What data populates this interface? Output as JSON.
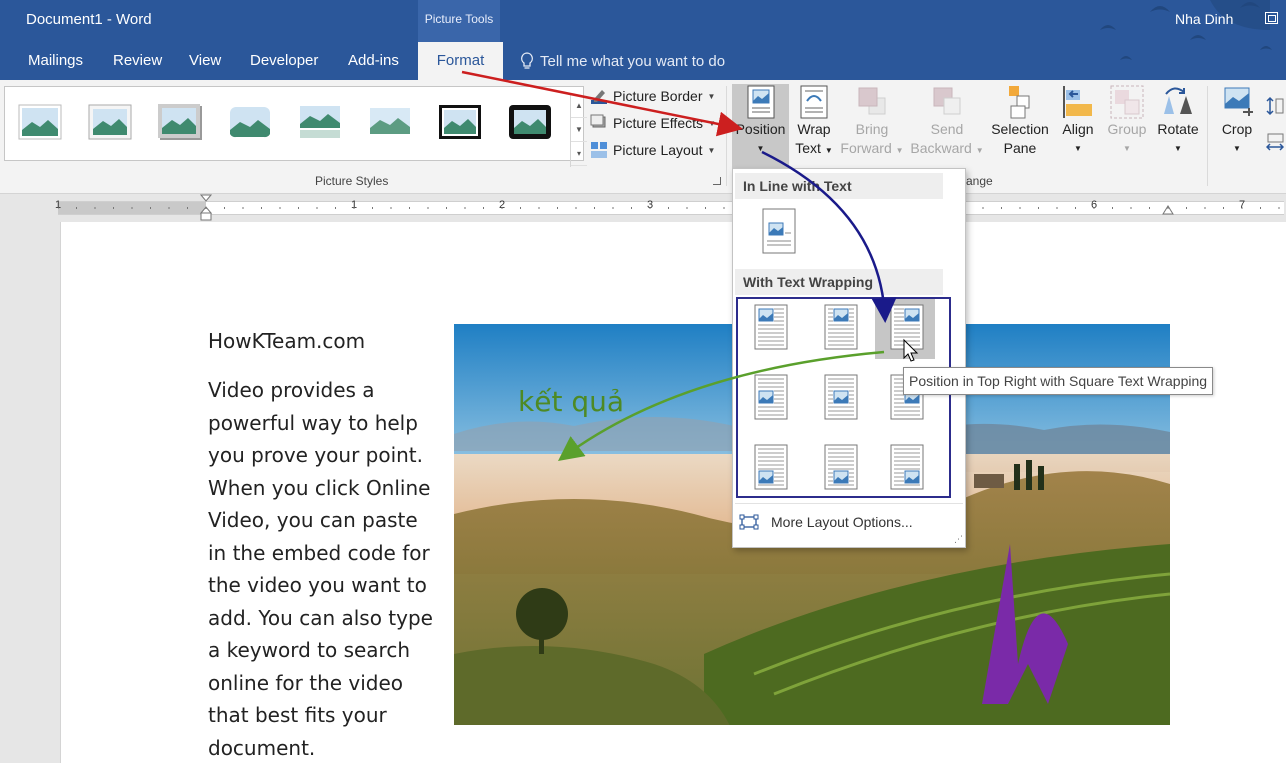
{
  "window": {
    "title": "Document1 - Word",
    "contextual_tab_group": "Picture Tools",
    "user_name": "Nha Dinh"
  },
  "tabs": [
    {
      "label": "Mailings"
    },
    {
      "label": "Review"
    },
    {
      "label": "View"
    },
    {
      "label": "Developer"
    },
    {
      "label": "Add-ins"
    }
  ],
  "active_tab": "Format",
  "tell_me": "Tell me what you want to do",
  "ribbon": {
    "picture_border": "Picture Border",
    "picture_effects": "Picture Effects",
    "picture_layout": "Picture Layout",
    "picture_styles_label": "Picture Styles",
    "arrange_label_fragment": "ange",
    "position": "Position",
    "wrap_text": [
      "Wrap",
      "Text"
    ],
    "bring_forward": [
      "Bring",
      "Forward"
    ],
    "send_backward": [
      "Send",
      "Backward"
    ],
    "selection_pane": [
      "Selection",
      "Pane"
    ],
    "align": "Align",
    "group": "Group",
    "rotate": "Rotate",
    "crop": "Crop"
  },
  "ruler": {
    "numbers": [
      "1",
      "1",
      "2",
      "3",
      "6",
      "7"
    ]
  },
  "document": {
    "heading": "HowKTeam.com",
    "body_lines": [
      "Video provides a",
      "powerful way to help",
      "you prove your point.",
      "When you click Online",
      "Video, you can paste",
      "in the embed code for",
      "the video you want to",
      "add. You can also type",
      "a keyword to search",
      "online for the video",
      "that best fits your",
      "document."
    ]
  },
  "position_menu": {
    "inline_header": "In Line with Text",
    "wrapping_header": "With Text Wrapping",
    "more_options": "More Layout Options...",
    "tooltip": "Position in Top Right with Square Text Wrapping"
  },
  "annotation": "kết quả",
  "colors": {
    "title_bar": "#2b579a",
    "ribbon": "#f3f3f3",
    "red_arrow": "#cc1f1f",
    "blue_arrow": "#1a1a8a",
    "green_arrow": "#5aa02c"
  }
}
